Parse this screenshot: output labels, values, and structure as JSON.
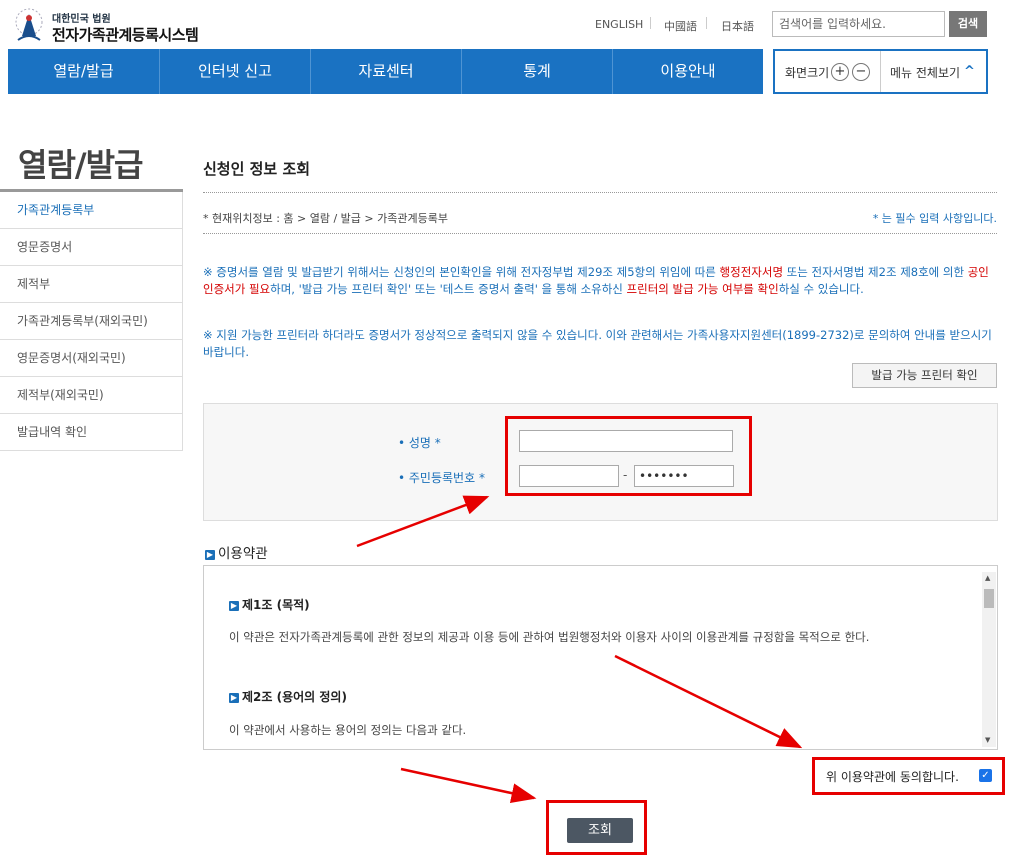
{
  "header": {
    "logo_sub": "대한민국 법원",
    "logo_main": "전자가족관계등록시스템",
    "languages": [
      "ENGLISH",
      "中國語",
      "日本語"
    ],
    "search_placeholder": "검색어를 입력하세요.",
    "search_button": "검색"
  },
  "gnb": [
    "열람/발급",
    "인터넷 신고",
    "자료센터",
    "통계",
    "이용안내"
  ],
  "util": {
    "zoom_label": "화면크기",
    "zoom_in": "+",
    "zoom_out": "−",
    "menu_all": "메뉴 전체보기"
  },
  "lnb": {
    "title": "열람/발급",
    "items": [
      "가족관계등록부",
      "영문증명서",
      "제적부",
      "가족관계등록부(재외국민)",
      "영문증명서(재외국민)",
      "제적부(재외국민)",
      "발급내역 확인"
    ]
  },
  "content": {
    "title": "신청인 정보 조회",
    "breadcrumb": "* 현재위치정보 : 홈 > 열람 / 발급 > 가족관계등록부",
    "required_note": "* 는 필수 입력 사항입니다.",
    "notice1": {
      "p1": "※ 증명서를 열람 및 발급받기 위해서는 신청인의 본인확인을 위해 전자정부법 제29조 제5항의 위임에 따른 ",
      "r1": "행정전자서명",
      "p2": " 또는 전자서명법 제2조 제8호에 의한 ",
      "r2": "공인인증서가 필요",
      "p3": "하며, '발급 가능 프린터 확인' 또는 '테스트 증명서 출력' 을 통해 소유하신 ",
      "r3": "프린터의 발급 가능 여부를 확인",
      "p4": "하실 수 있습니다."
    },
    "notice2": "※ 지원 가능한 프린터라 하더라도 증명서가 정상적으로 출력되지 않을 수 있습니다. 이와 관련해서는 가족사용자지원센터(1899-2732)로 문의하여 안내를 받으시기 바랍니다.",
    "printer_button": "발급 가능 프린터 확인"
  },
  "form": {
    "name_label": "• 성명 *",
    "name_value": "",
    "rrn_label": "• 주민등록번호 *",
    "rrn_front": "",
    "rrn_dash": "-",
    "rrn_back": "•••••••"
  },
  "terms": {
    "title": "이용약관",
    "articles": [
      {
        "title": "제1조 (목적)",
        "text": "이 약관은 전자가족관계등록에 관한 정보의 제공과 이용 등에 관하여 법원행정처와 이용자 사이의 이용관계를 규정함을 목적으로 한다."
      },
      {
        "title": "제2조 (용어의 정의)",
        "text": "이 약관에서 사용하는 용어의 정의는 다음과 같다."
      }
    ],
    "agree_label": "위 이용약관에 동의합니다.",
    "agree_checked": true
  },
  "submit_button": "조회",
  "colors": {
    "primary": "#1a72c2",
    "highlight": "#e60000"
  }
}
